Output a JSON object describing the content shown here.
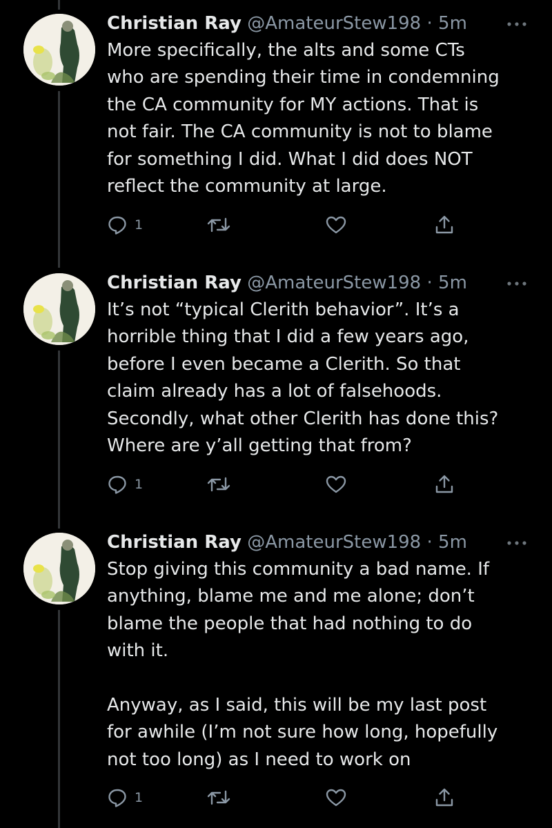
{
  "author": {
    "name": "Christian Ray",
    "handle": "@AmateurStew198",
    "separator": "·"
  },
  "icons": {
    "reply": "reply-bubble-icon",
    "retweet": "retweet-arrows-icon",
    "like": "heart-outline-icon",
    "share": "share-upload-icon",
    "more": "ellipsis-icon"
  },
  "colors": {
    "background": "#000000",
    "text": "#e7e9ea",
    "muted": "#8b98a5",
    "thread_line": "#333639"
  },
  "tweets": [
    {
      "time": "5m",
      "text": "More specifically, the alts and some CTs\nwho are spending their time in condemning\nthe CA community for MY actions. That is\nnot fair. The CA community is not to blame\nfor something I did. What I did does NOT\nreflect the community at large.",
      "reply_count": "1"
    },
    {
      "time": "5m",
      "text": "It’s not “typical Clerith behavior”. It’s a\nhorrible thing that I did a few years ago,\nbefore I even became a Clerith. So that\nclaim already has a lot of falsehoods.\nSecondly, what other Clerith has done this?\nWhere are y’all getting that from?",
      "reply_count": "1"
    },
    {
      "time": "5m",
      "text": "Stop giving this community a bad name. If\nanything, blame me and me alone; don’t\nblame the people that had nothing to do\nwith it.\n\nAnyway, as I said, this will be my last post\nfor awhile (I’m not sure how long, hopefully\nnot too long) as I need to work on",
      "reply_count": "1"
    }
  ]
}
